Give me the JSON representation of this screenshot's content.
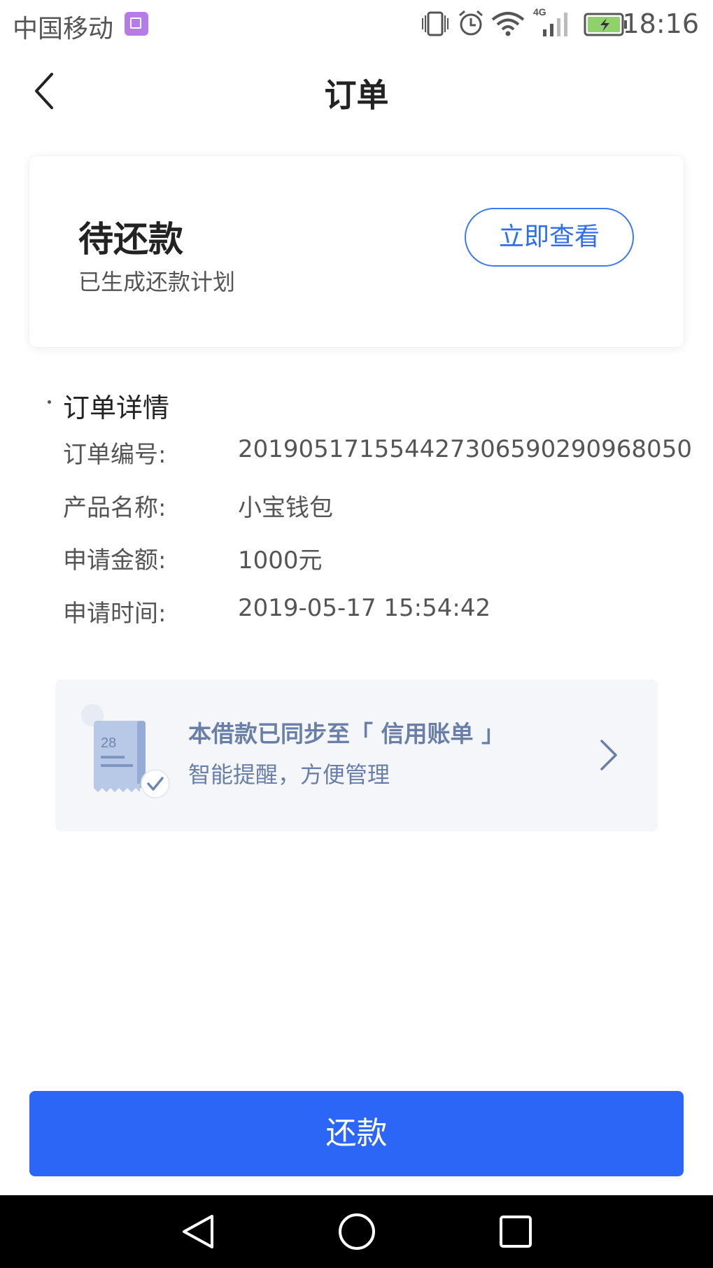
{
  "status_bar": {
    "carrier": "中国移动",
    "network": "4G",
    "time": "18:16"
  },
  "header": {
    "title": "订单"
  },
  "status_card": {
    "title": "待还款",
    "subtitle": "已生成还款计划",
    "button_label": "立即查看"
  },
  "details": {
    "section_title": "订单详情",
    "rows": [
      {
        "label": "订单编号:",
        "value": "2019051715544273065902909680​50"
      },
      {
        "label": "产品名称:",
        "value": "小宝钱包"
      },
      {
        "label": "申请金额:",
        "value": "1000元"
      },
      {
        "label": "申请时间:",
        "value": "2019-05-17 15:54:42"
      }
    ]
  },
  "sync_banner": {
    "title": "本借款已同步至「 信用账单 」",
    "subtitle": "智能提醒，方便管理",
    "receipt_number": "28"
  },
  "footer": {
    "repay_label": "还款"
  },
  "colors": {
    "accent": "#2b66f6",
    "banner_text": "#6a7fa8",
    "banner_bg": "#f4f6fa"
  },
  "icons": {
    "back": "chevron-left-icon",
    "sync_arrow": "chevron-right-icon",
    "receipt": "receipt-icon"
  }
}
